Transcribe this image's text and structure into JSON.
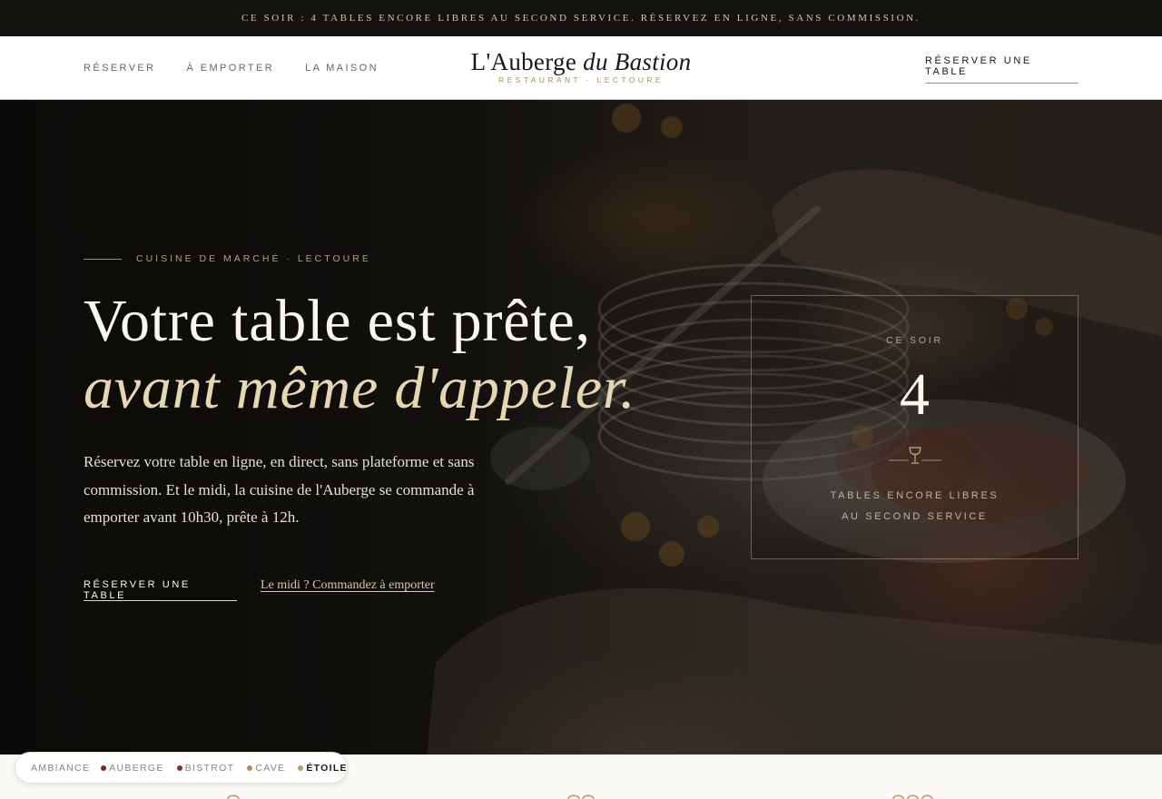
{
  "announcement": "CE SOIR : 4 TABLES ENCORE LIBRES AU SECOND SERVICE. RÉSERVEZ EN LIGNE, SANS COMMISSION.",
  "nav": {
    "links": [
      "RÉSERVER",
      "À EMPORTER",
      "LA MAISON"
    ],
    "brand": {
      "name_main": "L'Auberge ",
      "name_italic": "du Bastion",
      "subtitle": "RESTAURANT · LECTOURE"
    },
    "cta": "RÉSERVER UNE TABLE"
  },
  "hero": {
    "eyebrow": "CUISINE DE MARCHÉ · LECTOURE",
    "title_line1": "Votre table est prête,",
    "title_line2": "avant même d'appeler.",
    "lede": "Réservez votre table en ligne, en direct, sans plateforme et sans commission. Et le midi, la cuisine de l'Auberge se commande à emporter avant 10h30, prête à 12h.",
    "primary_cta": "RÉSERVER UNE TABLE",
    "secondary_link": "Le midi ? Commandez à emporter"
  },
  "tonight": {
    "label": "CE SOIR",
    "count": "4",
    "desc_line1": "TABLES ENCORE LIBRES",
    "desc_line2": "AU SECOND SERVICE",
    "icon": "wine-glass-icon"
  },
  "theme_switcher": {
    "label": "AMBIANCE",
    "options": [
      {
        "label": "AUBERGE",
        "dot": "#7a2a24",
        "active": false
      },
      {
        "label": "BISTROT",
        "dot": "#8f2a2a",
        "active": false
      },
      {
        "label": "CAVE",
        "dot": "#b88a5a",
        "active": false
      },
      {
        "label": "ÉTOILE",
        "dot": "#b8a070",
        "active": true
      }
    ]
  },
  "colors": {
    "gold": "#b49a68",
    "ink": "#1a1714",
    "cream": "#faf7ef",
    "bar": "#13120f"
  }
}
